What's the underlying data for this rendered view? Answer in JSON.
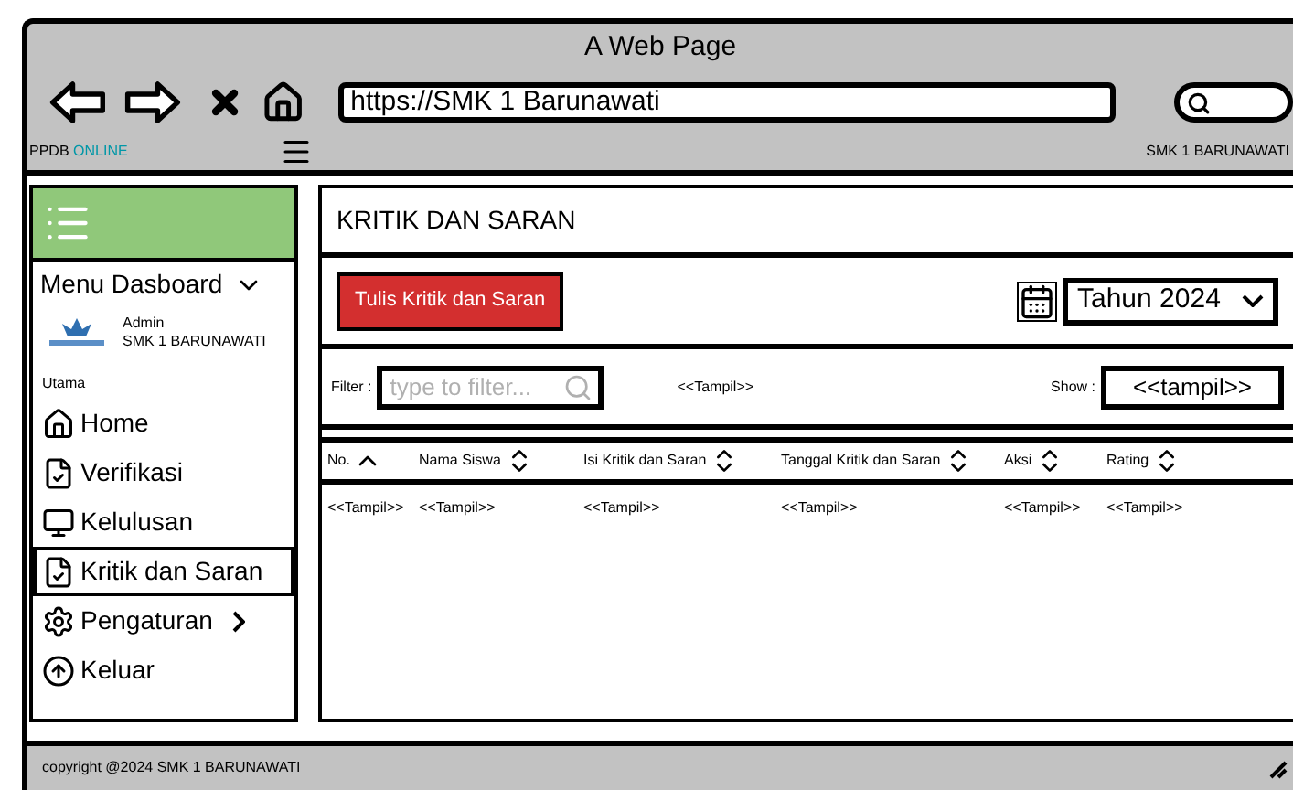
{
  "window": {
    "title": "A Web Page"
  },
  "browser": {
    "url": "https://SMK 1 Barunawati"
  },
  "header": {
    "brand": "PPDB",
    "brand_highlight": "ONLINE",
    "user": "SMK 1 BARUNAWATI"
  },
  "sidebar": {
    "menu_title": "Menu Dasboard",
    "admin_role": "Admin",
    "admin_name": "SMK 1 BARUNAWATI",
    "section": "Utama",
    "items": [
      {
        "label": "Home",
        "selected": false,
        "has_submenu": false
      },
      {
        "label": "Verifikasi",
        "selected": false,
        "has_submenu": false
      },
      {
        "label": "Kelulusan",
        "selected": false,
        "has_submenu": false
      },
      {
        "label": "Kritik dan Saran",
        "selected": true,
        "has_submenu": false
      },
      {
        "label": "Pengaturan",
        "selected": false,
        "has_submenu": true
      },
      {
        "label": "Keluar",
        "selected": false,
        "has_submenu": false
      }
    ]
  },
  "main": {
    "title": "KRITIK DAN SARAN",
    "add_button": "Tulis Kritik dan Saran",
    "year_select": "Tahun 2024",
    "filter": {
      "label": "Filter :",
      "placeholder": "type to filter...",
      "hint": "<<Tampil>>"
    },
    "show": {
      "label": "Show :",
      "value": "<<tampil>>"
    },
    "table": {
      "columns": [
        {
          "label": "No.",
          "sorted": true
        },
        {
          "label": "Nama Siswa",
          "sorted": false
        },
        {
          "label": "Isi Kritik dan Saran",
          "sorted": false
        },
        {
          "label": "Tanggal Kritik dan Saran",
          "sorted": false
        },
        {
          "label": "Aksi",
          "sorted": false
        },
        {
          "label": "Rating",
          "sorted": false
        }
      ],
      "rows": [
        [
          "<<Tampil>>",
          "<<Tampil>>",
          "<<Tampil>>",
          "<<Tampil>>",
          "<<Tampil>>",
          "<<Tampil>>"
        ]
      ]
    }
  },
  "footer": {
    "text": "copyright @2024 SMK 1 BARUNAWATI"
  }
}
